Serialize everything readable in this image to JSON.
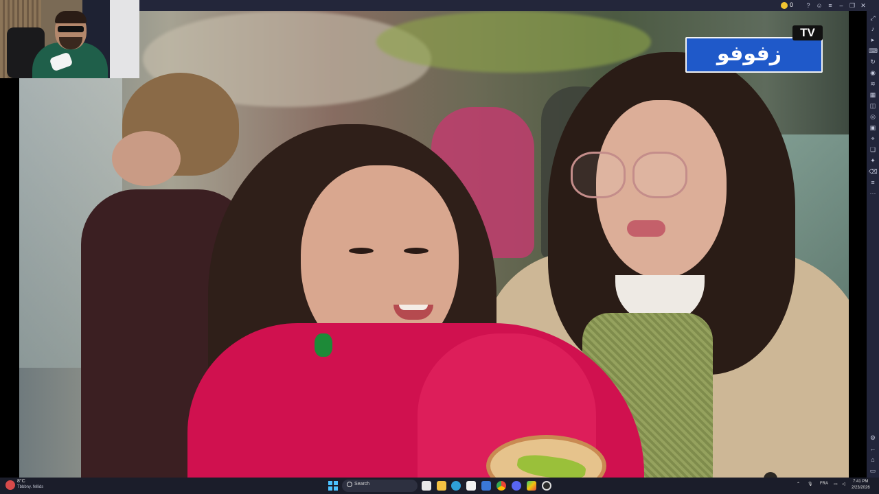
{
  "titlebar": {
    "coin_count": "0",
    "icons": [
      "help-icon",
      "user-icon",
      "menu-icon",
      "minimize-icon",
      "restore-icon",
      "close-icon"
    ]
  },
  "video": {
    "channel_logo_text": "زفوفو",
    "channel_logo_badge": "TV"
  },
  "sidebar": {
    "icons": [
      "expand-icon",
      "volume-icon",
      "play-icon",
      "keyboard-icon",
      "rotate-icon",
      "gamepad-icon",
      "shake-icon",
      "scan-icon",
      "screenshot-icon",
      "record-icon",
      "image-icon",
      "location-icon",
      "multi-instance-icon",
      "eco-icon",
      "delete-icon",
      "layers-icon",
      "more-icon",
      "settings-icon",
      "back-icon",
      "home-icon",
      "recents-icon"
    ]
  },
  "taskbar": {
    "weather_temp": "8°C",
    "weather_desc": "Tbbbny. fellids",
    "search_placeholder": "Search",
    "apps": [
      "file-explorer-icon",
      "folder-icon",
      "edge-icon",
      "store-icon",
      "mail-icon",
      "chrome-icon",
      "discord-icon",
      "bluestacks-icon",
      "obs-icon"
    ],
    "language": "FRA",
    "time": "7:41 PM",
    "date": "2/23/2026"
  }
}
